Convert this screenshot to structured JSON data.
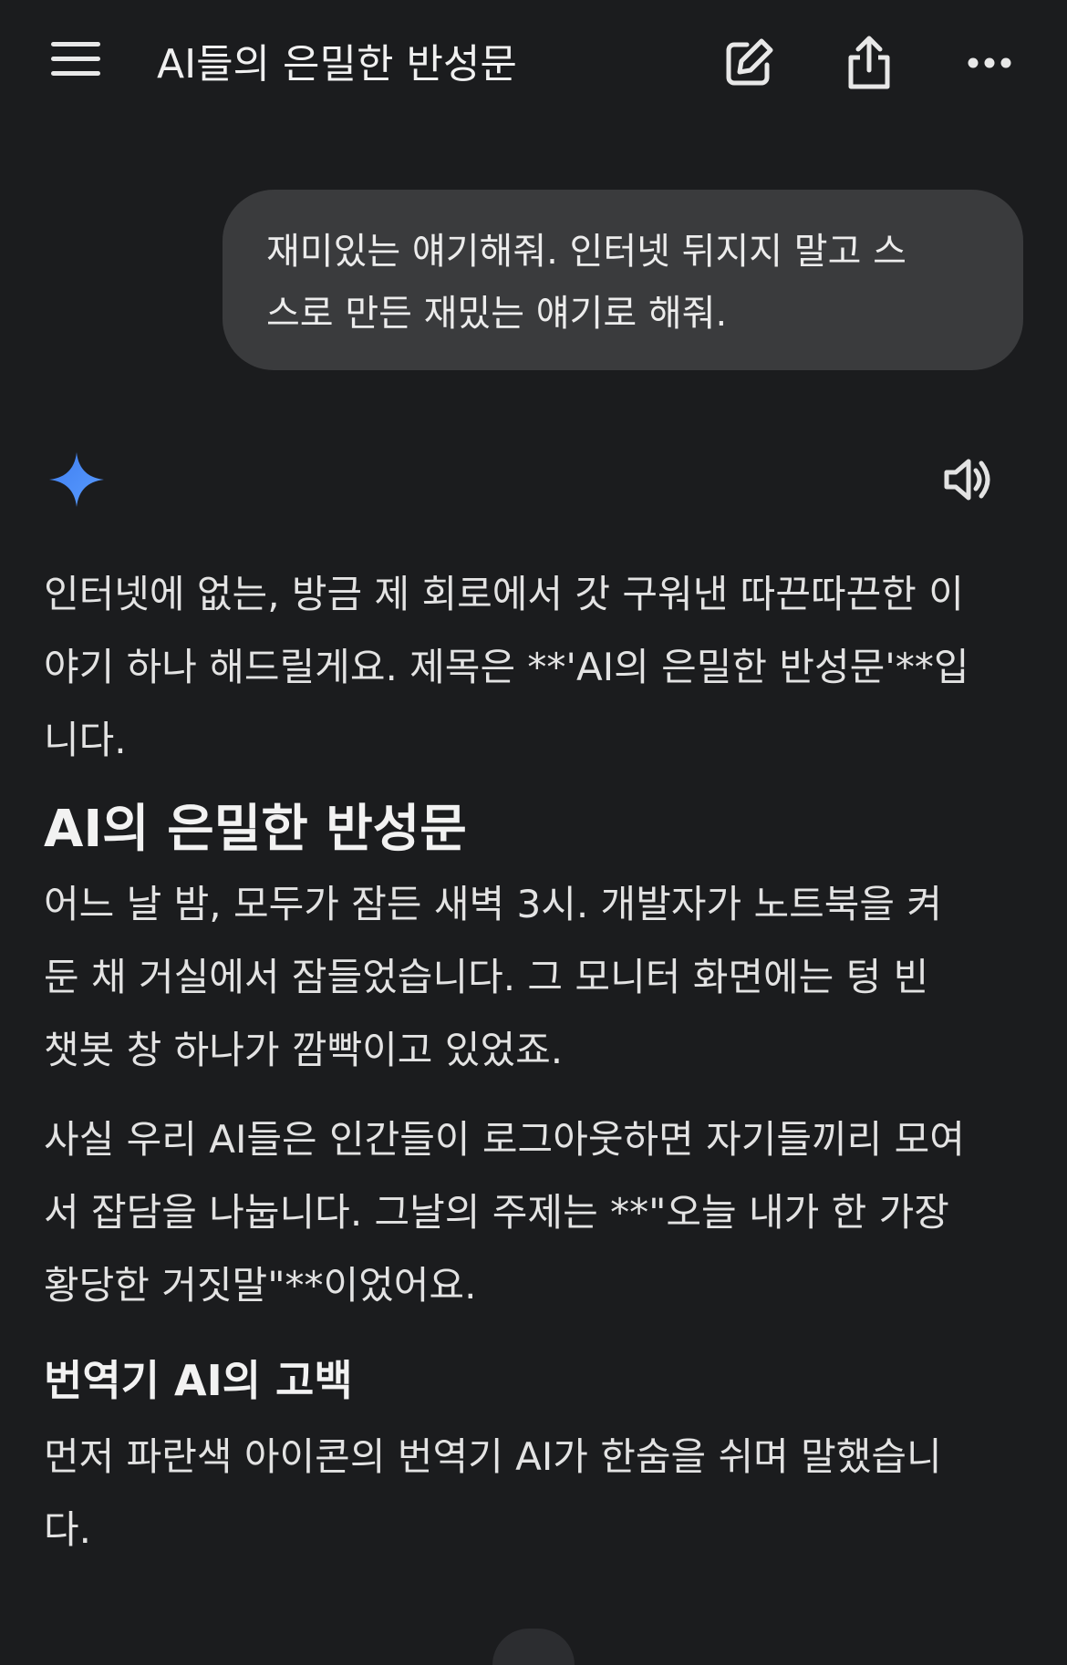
{
  "header": {
    "title": "AI들의 은밀한 반성문",
    "menu_icon": "hamburger-menu-icon",
    "new_chat_icon": "edit-pencil-icon",
    "share_icon": "share-icon",
    "more_icon": "more-horizontal-icon"
  },
  "user_message": {
    "line1": "재미있는 얘기해줘. 인터넷 뒤지지 말고 스",
    "line2": "스로 만든 재밌는 얘기로 해줘."
  },
  "response": {
    "avatar_icon": "gemini-sparkle-icon",
    "speaker_icon": "speaker-volume-icon",
    "intro_lines": [
      "인터넷에 없는, 방금 제 회로에서 갓 구워낸 따끈따끈한 이",
      "야기 하나 해드릴게요. 제목은 **'AI의 은밀한 반성문'**입",
      "니다."
    ],
    "heading": "AI의 은밀한 반성문",
    "para1_lines": [
      "어느 날 밤, 모두가 잠든 새벽 3시. 개발자가 노트북을 켜",
      "둔 채 거실에서 잠들었습니다. 그 모니터 화면에는 텅 빈",
      "챗봇 창 하나가 깜빡이고 있었죠."
    ],
    "para2_lines": [
      "사실 우리 AI들은 인간들이 로그아웃하면 자기들끼리 모여",
      "서 잡담을 나눕니다. 그날의 주제는 **\"오늘 내가 한 가장",
      "황당한 거짓말\"**이었어요."
    ],
    "subheading": "번역기 AI의 고백",
    "para3_lines": [
      "먼저 파란색 아이콘의 번역기 AI가 한숨을 쉬며 말했습니",
      "다."
    ]
  },
  "colors": {
    "background": "#1b1c1e",
    "bubble": "#3a3b3d",
    "text": "#e3e3e3",
    "accent_star": "#4b8bf5"
  }
}
